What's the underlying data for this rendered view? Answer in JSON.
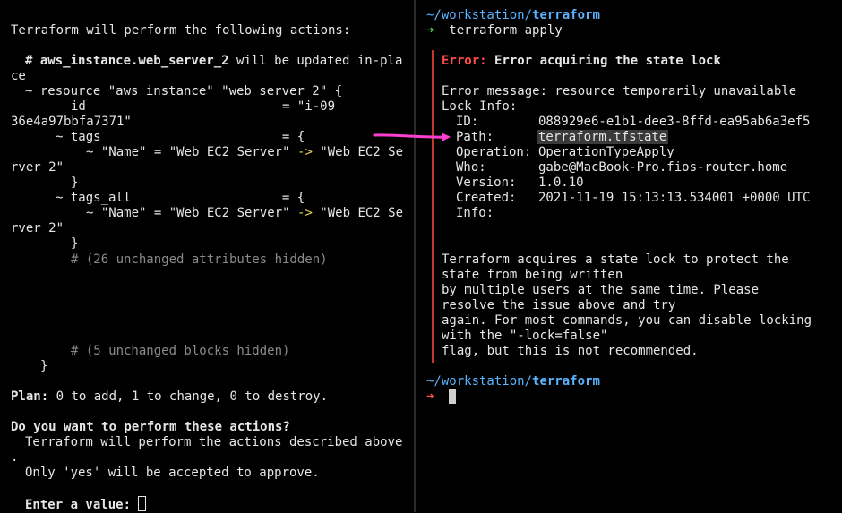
{
  "left_pane": {
    "intro": "Terraform will perform the following actions:",
    "resource_comment_prefix": "# ",
    "resource_comment_name": "aws_instance.web_server_2",
    "resource_comment_suffix": " will be updated in-pla",
    "resource_comment_wrap": "ce",
    "resource_line": "~ resource \"aws_instance\" \"web_server_2\" {",
    "id_line": "id                          = \"i-09",
    "id_wrap": "36e4a97bbfa7371\"",
    "tags_line": "~ tags                        = {",
    "tags_name_left": "~ \"Name\" = \"Web EC2 Server\" ",
    "arrow_symbol": "->",
    "tags_name_right": " \"Web EC2 Se",
    "tags_name_wrap": "rver 2\"",
    "close_brace": "}",
    "tags_all_line": "~ tags_all                    = {",
    "unchanged_attributes": "# (26 unchanged attributes hidden)",
    "unchanged_blocks": "# (5 unchanged blocks hidden)",
    "plan_label": "Plan:",
    "plan_text": " 0 to add, 1 to change, 0 to destroy.",
    "question": "Do you want to perform these actions?",
    "perform_line": "Terraform will perform the actions described above",
    "perform_wrap": ".",
    "only_yes": "Only 'yes' will be accepted to approve.",
    "enter_value_label": "Enter a value:"
  },
  "right_pane": {
    "prompt_path_prefix": "~/workstation/",
    "prompt_path_dir": "terraform",
    "prompt_symbol": "➜",
    "command": "terraform apply",
    "error_label": "Error:",
    "error_title": " Error acquiring the state lock",
    "error_message": "Error message: resource temporarily unavailable",
    "lock_info_label": "Lock Info:",
    "lock_info": [
      {
        "key": "ID:",
        "value": "088929e6-e1b1-dee3-8ffd-ea95ab6a3ef5"
      },
      {
        "key": "Path:",
        "value": "terraform.tfstate"
      },
      {
        "key": "Operation:",
        "value": "OperationTypeApply"
      },
      {
        "key": "Who:",
        "value": "gabe@MacBook-Pro.fios-router.home"
      },
      {
        "key": "Version:",
        "value": "1.0.10"
      },
      {
        "key": "Created:",
        "value": "2021-11-19 15:13:13.534001 +0000 UTC"
      },
      {
        "key": "Info:",
        "value": ""
      }
    ],
    "explanation": [
      "Terraform acquires a state lock to protect the",
      "state from being written",
      "by multiple users at the same time. Please",
      "resolve the issue above and try",
      "again. For most commands, you can disable locking",
      "with the \"-lock=false\"",
      "flag, but this is not recommended."
    ],
    "prompt2_path_prefix": "~/workstation/",
    "prompt2_path_dir": "terraform",
    "prompt2_symbol": "➜"
  },
  "colors": {
    "error_red": "#ff4d4d",
    "prompt_blue": "#5ab4ff",
    "arrow_magenta": "#ff3fd0",
    "diff_yellow": "#e8d44d",
    "prompt_green": "#4ed44e"
  }
}
